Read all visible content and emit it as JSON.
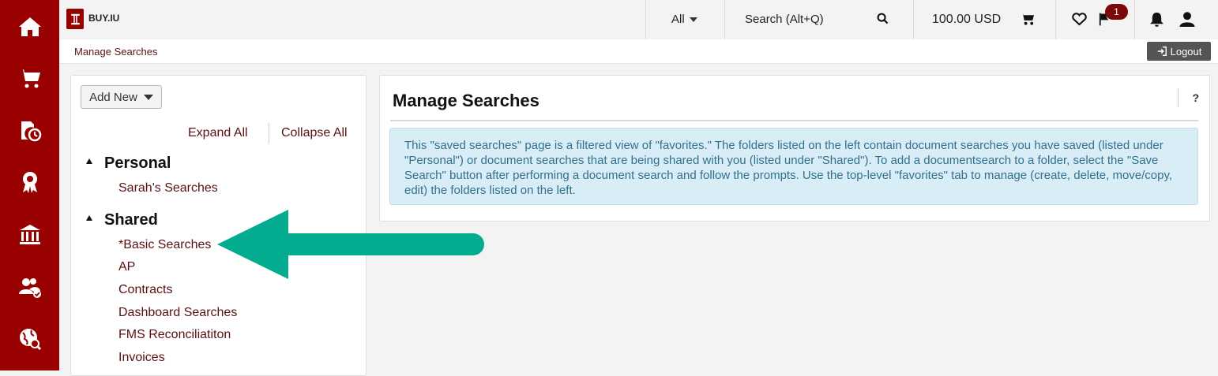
{
  "header": {
    "brand": "BUY.IU",
    "search_scope": "All",
    "search_placeholder": "Search (Alt+Q)",
    "cart_total": "100.00 USD",
    "notification_count": "1",
    "logout_label": "Logout"
  },
  "breadcrumb": "Manage Searches",
  "left_panel": {
    "add_new_label": "Add New",
    "expand_all": "Expand All",
    "collapse_all": "Collapse All",
    "groups": [
      {
        "title": "Personal",
        "folders": [
          "Sarah's Searches"
        ]
      },
      {
        "title": "Shared",
        "folders": [
          "*Basic Searches",
          "AP",
          "Contracts",
          "Dashboard Searches",
          "FMS Reconciliatiton",
          "Invoices"
        ]
      }
    ]
  },
  "main": {
    "title": "Manage Searches",
    "help_label": "?",
    "info_text": "This \"saved searches\" page is a filtered view of \"favorites.\" The folders listed on the left contain document searches you have saved (listed under \"Personal\") or document searches that are being shared with you (listed under \"Shared\"). To add a documentsearch to a folder, select the \"Save Search\" button after performing a document search and follow the prompts. Use the top-level \"favorites\" tab to manage (create, delete, move/copy, edit) the folders listed on the left."
  },
  "colors": {
    "brand_red": "#990000",
    "link": "#5a1010",
    "info_bg": "#d9edf7",
    "info_text": "#31708f",
    "annotation_arrow": "#03ac8e"
  },
  "sidebar_icons": [
    "home-icon",
    "cart-icon",
    "documents-clock-icon",
    "award-icon",
    "bank-icon",
    "users-check-icon",
    "globe-search-icon"
  ]
}
